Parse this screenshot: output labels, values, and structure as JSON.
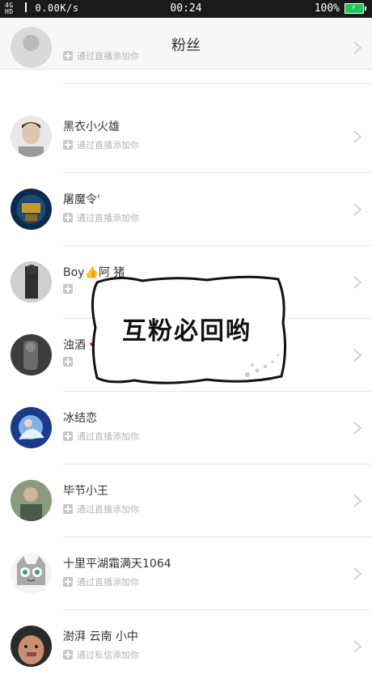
{
  "status_bar": {
    "signal_top": "4G",
    "signal_bottom": "HD",
    "speed": "0.00K/s",
    "time": "00:24",
    "battery": "100%",
    "battery_icon": "battery-charging-icon"
  },
  "header": {
    "title": "粉丝",
    "back_icon": "chevron-left-icon"
  },
  "fans": [
    {
      "name": "",
      "sub": "通过直播添加你"
    },
    {
      "name": "黑衣小火雄",
      "sub": "通过直播添加你"
    },
    {
      "name": "屠魔令'",
      "sub": "通过直播添加你"
    },
    {
      "name": "Boy👍阿  猪",
      "sub": ""
    },
    {
      "name": "浊酒🍷",
      "sub": ""
    },
    {
      "name": "冰结恋",
      "sub": "通过直播添加你"
    },
    {
      "name": "毕节小王",
      "sub": "通过直播添加你"
    },
    {
      "name": "十里平湖霜满天1064",
      "sub": "通过直播添加你"
    },
    {
      "name": "澍湃  云南  小中",
      "sub": "通过私信添加你"
    }
  ],
  "overlay": {
    "text": "互粉必回哟"
  },
  "colors": {
    "status_bar_bg": "#1a1a1a",
    "nav_bg": "#f7f7f7",
    "battery": "#22c55e",
    "sub_text": "#b5b5b5"
  }
}
